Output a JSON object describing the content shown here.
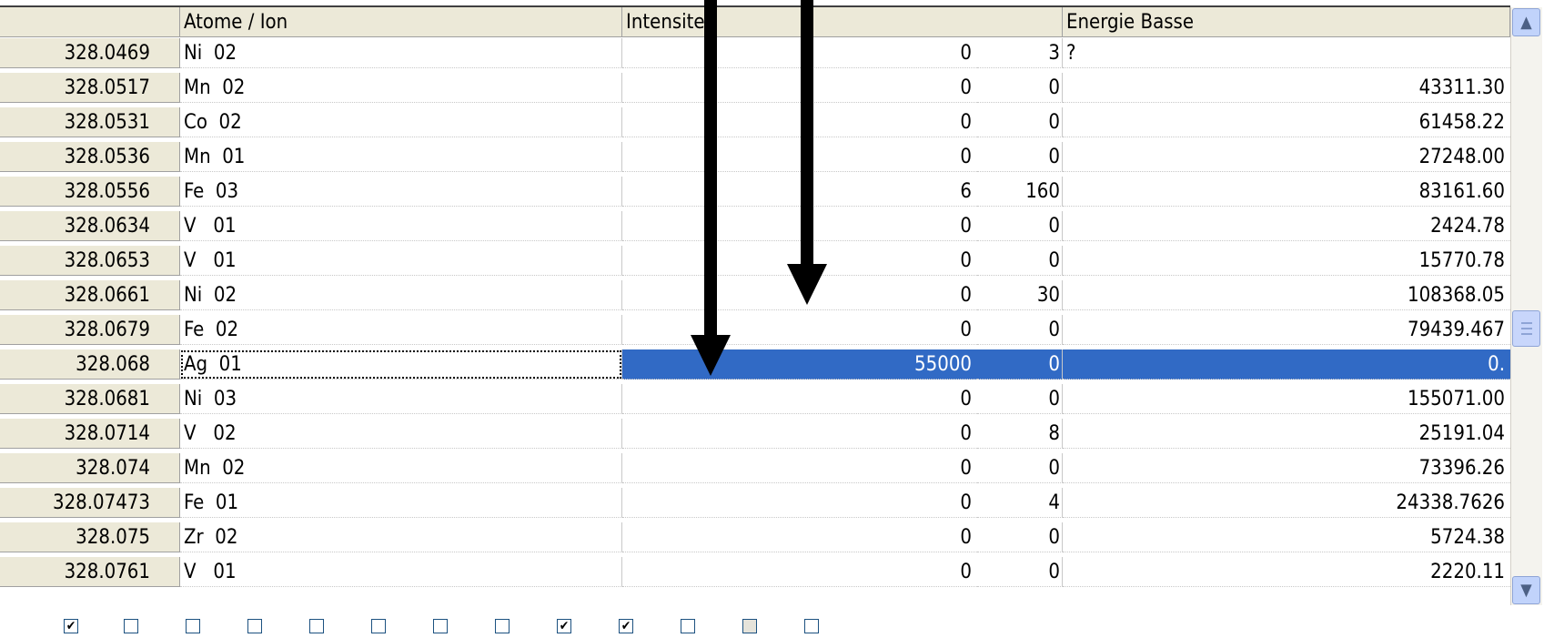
{
  "columns": [
    "",
    "Atome / Ion",
    "Intensites",
    "Energie Basse"
  ],
  "rows": [
    {
      "key": "328.0469",
      "atom": "Ni  02",
      "int_a": "0",
      "int_b": "3",
      "energy": "?"
    },
    {
      "key": "328.0517",
      "atom": "Mn  02",
      "int_a": "0",
      "int_b": "0",
      "energy": "43311.30"
    },
    {
      "key": "328.0531",
      "atom": "Co  02",
      "int_a": "0",
      "int_b": "0",
      "energy": "61458.22"
    },
    {
      "key": "328.0536",
      "atom": "Mn  01",
      "int_a": "0",
      "int_b": "0",
      "energy": "27248.00"
    },
    {
      "key": "328.0556",
      "atom": "Fe  03",
      "int_a": "6",
      "int_b": "160",
      "energy": "83161.60"
    },
    {
      "key": "328.0634",
      "atom": "V   01",
      "int_a": "0",
      "int_b": "0",
      "energy": "2424.78"
    },
    {
      "key": "328.0653",
      "atom": "V   01",
      "int_a": "0",
      "int_b": "0",
      "energy": "15770.78"
    },
    {
      "key": "328.0661",
      "atom": "Ni  02",
      "int_a": "0",
      "int_b": "30",
      "energy": "108368.05"
    },
    {
      "key": "328.0679",
      "atom": "Fe  02",
      "int_a": "0",
      "int_b": "0",
      "energy": "79439.467"
    },
    {
      "key": "328.068",
      "atom": "Ag  01",
      "int_a": "55000",
      "int_b": "0",
      "energy": "0.",
      "selected": true
    },
    {
      "key": "328.0681",
      "atom": "Ni  03",
      "int_a": "0",
      "int_b": "0",
      "energy": "155071.00"
    },
    {
      "key": "328.0714",
      "atom": "V   02",
      "int_a": "0",
      "int_b": "8",
      "energy": "25191.04"
    },
    {
      "key": "328.074",
      "atom": "Mn  02",
      "int_a": "0",
      "int_b": "0",
      "energy": "73396.26"
    },
    {
      "key": "328.07473",
      "atom": "Fe  01",
      "int_a": "0",
      "int_b": "4",
      "energy": "24338.7626"
    },
    {
      "key": "328.075",
      "atom": "Zr  02",
      "int_a": "0",
      "int_b": "0",
      "energy": "5724.38"
    },
    {
      "key": "328.0761",
      "atom": "V   01",
      "int_a": "0",
      "int_b": "0",
      "energy": "2220.11"
    }
  ],
  "checkboxes": [
    {
      "checked": true,
      "disabled": false
    },
    {
      "checked": false,
      "disabled": false
    },
    {
      "checked": false,
      "disabled": false
    },
    {
      "checked": false,
      "disabled": false
    },
    {
      "checked": false,
      "disabled": false
    },
    {
      "checked": false,
      "disabled": false
    },
    {
      "checked": false,
      "disabled": false
    },
    {
      "checked": false,
      "disabled": false
    },
    {
      "checked": true,
      "disabled": false
    },
    {
      "checked": true,
      "disabled": false
    },
    {
      "checked": false,
      "disabled": false
    },
    {
      "checked": false,
      "disabled": true
    },
    {
      "checked": false,
      "disabled": false
    }
  ],
  "icons": {
    "scroll_up": "scroll-up-arrow-icon",
    "scroll_down": "scroll-down-arrow-icon",
    "annotation": "down-arrow-icon"
  },
  "colors": {
    "selection": "#316ac5",
    "header": "#ece9d8",
    "annotation": "#000000"
  }
}
